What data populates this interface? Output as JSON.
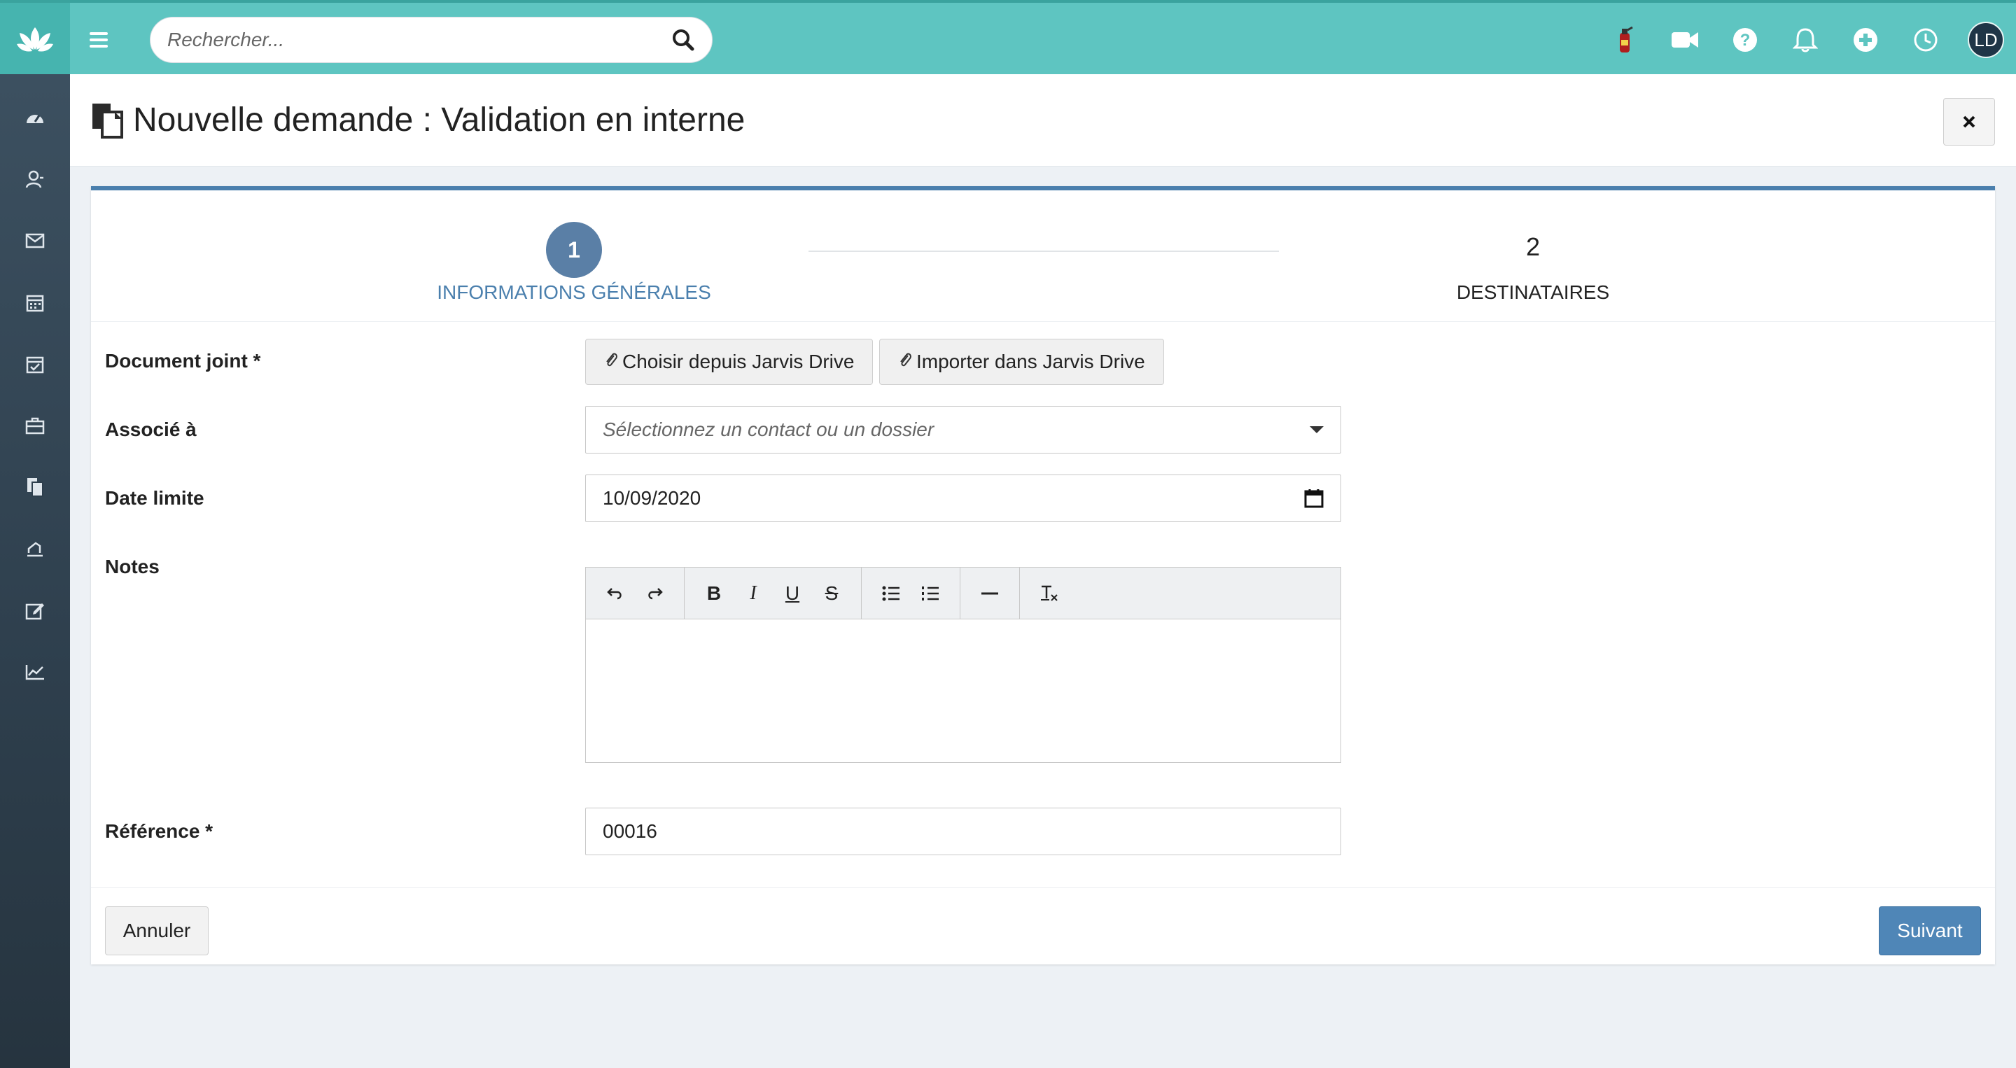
{
  "search": {
    "placeholder": "Rechercher..."
  },
  "header": {
    "avatar_initials": "LD"
  },
  "sidebar": {
    "items": [
      {
        "icon": "dashboard-icon"
      },
      {
        "icon": "contacts-icon"
      },
      {
        "icon": "mail-icon"
      },
      {
        "icon": "calendar-icon"
      },
      {
        "icon": "tasks-icon"
      },
      {
        "icon": "briefcase-icon"
      },
      {
        "icon": "documents-icon"
      },
      {
        "icon": "signature-icon"
      },
      {
        "icon": "edit-icon"
      },
      {
        "icon": "chart-icon"
      }
    ]
  },
  "page": {
    "title": "Nouvelle demande : Validation en interne"
  },
  "steps": [
    {
      "number": "1",
      "label": "INFORMATIONS GÉNÉRALES",
      "active": true
    },
    {
      "number": "2",
      "label": "DESTINATAIRES",
      "active": false
    }
  ],
  "form": {
    "document_label": "Document joint *",
    "choose_drive_label": "Choisir depuis Jarvis Drive",
    "import_drive_label": "Importer dans Jarvis Drive",
    "associated_label": "Associé à",
    "associated_placeholder": "Sélectionnez un contact ou un dossier",
    "deadline_label": "Date limite",
    "deadline_value": "10/09/2020",
    "notes_label": "Notes",
    "reference_label": "Référence *",
    "reference_value": "00016"
  },
  "editor_toolbar": {
    "bold": "B",
    "italic": "I",
    "underline": "U",
    "strike": "S"
  },
  "footer": {
    "cancel_label": "Annuler",
    "next_label": "Suivant"
  },
  "colors": {
    "topbar": "#5ec5c1",
    "accent": "#4a7fad",
    "sidebar": "#2e3f4d",
    "primary_button": "#4f86b7"
  }
}
